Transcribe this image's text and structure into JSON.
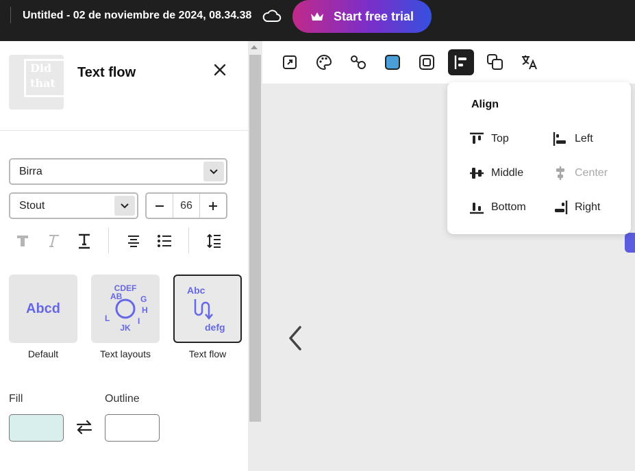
{
  "topbar": {
    "title": "Untitled - 02 de noviembre de 2024, 08.34.38",
    "cloud_icon": "cloud-icon",
    "trial_button": "Start free trial",
    "trial_icon": "crown-icon"
  },
  "panel": {
    "title": "Text flow",
    "thumbnail_text": [
      "Did",
      "that"
    ],
    "font_family": "Birra",
    "font_style": "Stout",
    "font_size": "66",
    "text_tools": [
      "bold-t-icon",
      "italic-t-icon",
      "underline-t-icon",
      "align-center-icon",
      "list-icon",
      "line-spacing-icon"
    ],
    "presets": [
      {
        "label": "Default",
        "preview": "Abcd"
      },
      {
        "label": "Text layouts",
        "preview": "ABCDEFGHIJKL"
      },
      {
        "label": "Text flow",
        "preview_top": "Abc",
        "preview_bottom": "defg",
        "selected": true
      }
    ],
    "fill_label": "Fill",
    "outline_label": "Outline",
    "fill_color": "#d9efee",
    "outline_color": "#ffffff"
  },
  "toolbar": {
    "items": [
      "resize-icon",
      "palette-icon",
      "shapes-icon",
      "color-square-icon",
      "border-icon",
      "align-icon",
      "duplicate-icon",
      "translate-icon"
    ],
    "active": "align-icon"
  },
  "align_popover": {
    "title": "Align",
    "options": [
      {
        "label": "Top",
        "icon": "align-top-icon",
        "enabled": true
      },
      {
        "label": "Left",
        "icon": "align-left-icon",
        "enabled": true
      },
      {
        "label": "Middle",
        "icon": "align-middle-icon",
        "enabled": true
      },
      {
        "label": "Center",
        "icon": "align-center-h-icon",
        "enabled": false
      },
      {
        "label": "Bottom",
        "icon": "align-bottom-icon",
        "enabled": true
      },
      {
        "label": "Right",
        "icon": "align-right-icon",
        "enabled": true
      }
    ]
  },
  "colors": {
    "topbar_bg": "#1f1f1f",
    "accent": "#6667e6",
    "canvas_bg": "#ebebeb"
  }
}
